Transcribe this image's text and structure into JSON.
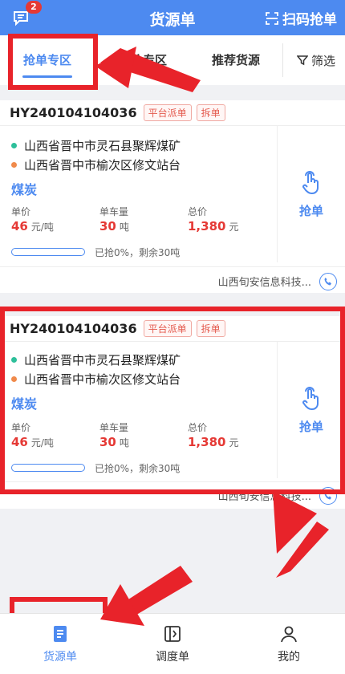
{
  "header": {
    "title": "货源单",
    "message_badge": "2",
    "scan_label": "扫码抢单"
  },
  "tabs": {
    "items": [
      {
        "label": "抢单专区"
      },
      {
        "label": "报价专区"
      },
      {
        "label": "推荐货源"
      }
    ],
    "filter_label": "筛选"
  },
  "cards": [
    {
      "order_no": "HY240104104036",
      "tags": [
        "平台派单",
        "拆单"
      ],
      "origin": "山西省晋中市灵石县聚辉煤矿",
      "destination": "山西省晋中市榆次区修文站台",
      "goods": "煤炭",
      "unit_price_label": "单价",
      "unit_price_value": "46",
      "unit_price_unit": "元/吨",
      "per_truck_label": "单车量",
      "per_truck_value": "30",
      "per_truck_unit": "吨",
      "total_label": "总价",
      "total_value": "1,380",
      "total_unit": "元",
      "progress": 0,
      "progress_text": "已抢0%，剩余30吨",
      "grab_label": "抢单",
      "company": "山西旬安信息科技..."
    },
    {
      "order_no": "HY240104104036",
      "tags": [
        "平台派单",
        "拆单"
      ],
      "origin": "山西省晋中市灵石县聚辉煤矿",
      "destination": "山西省晋中市榆次区修文站台",
      "goods": "煤炭",
      "unit_price_label": "单价",
      "unit_price_value": "46",
      "unit_price_unit": "元/吨",
      "per_truck_label": "单车量",
      "per_truck_value": "30",
      "per_truck_unit": "吨",
      "total_label": "总价",
      "total_value": "1,380",
      "total_unit": "元",
      "progress": 0,
      "progress_text": "已抢0%，剩余30吨",
      "grab_label": "抢单",
      "company": "山西旬安信息科技..."
    }
  ],
  "bottom_nav": [
    {
      "label": "货源单",
      "icon": "document-icon"
    },
    {
      "label": "调度单",
      "icon": "dispatch-icon"
    },
    {
      "label": "我的",
      "icon": "person-icon"
    }
  ],
  "colors": {
    "primary": "#4d8af0",
    "price_red": "#e53935",
    "annotation_red": "#e8232a"
  }
}
